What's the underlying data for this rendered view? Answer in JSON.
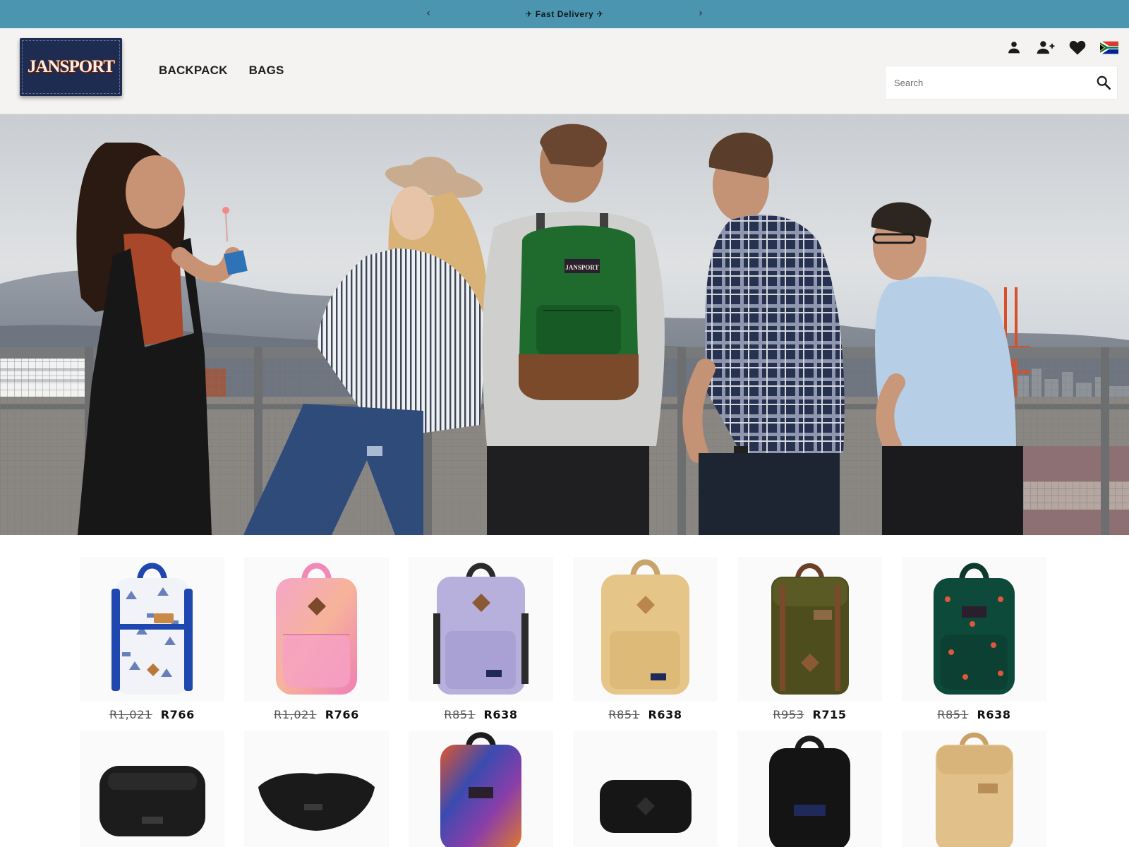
{
  "announcement": {
    "prev_icon": "chevron-left-icon",
    "next_icon": "chevron-right-icon",
    "plane_icon": "airplane-icon",
    "text": "Fast Delivery",
    "background": "#4b95b0"
  },
  "header": {
    "logo_text": "JANSPORT",
    "nav": [
      "BACKPACK",
      "BAGS"
    ],
    "icons": [
      "account-icon",
      "register-icon",
      "wishlist-icon",
      "south-africa-flag-icon"
    ],
    "search": {
      "placeholder": "Search",
      "value": "",
      "button_icon": "search-icon"
    }
  },
  "hero": {
    "image": "friends-at-waterfront-railing-with-green-backpack"
  },
  "products": [
    {
      "image": "white-blue-print-backpack",
      "old_price": "R1,021",
      "price": "R766"
    },
    {
      "image": "pink-tie-dye-backpack",
      "old_price": "R1,021",
      "price": "R766"
    },
    {
      "image": "lavender-backpack",
      "old_price": "R851",
      "price": "R638"
    },
    {
      "image": "tan-backpack",
      "old_price": "R851",
      "price": "R638"
    },
    {
      "image": "olive-hiker-backpack",
      "old_price": "R953",
      "price": "R715"
    },
    {
      "image": "dark-green-print-backpack",
      "old_price": "R851",
      "price": "R638"
    },
    {
      "image": "black-waist-pack",
      "old_price": "",
      "price": ""
    },
    {
      "image": "black-fanny-pack",
      "old_price": "",
      "price": ""
    },
    {
      "image": "tie-dye-big-student-backpack",
      "old_price": "",
      "price": ""
    },
    {
      "image": "black-mini-waist-pack",
      "old_price": "",
      "price": ""
    },
    {
      "image": "black-backpack",
      "old_price": "",
      "price": ""
    },
    {
      "image": "tan-hiker-backpack",
      "old_price": "",
      "price": ""
    }
  ]
}
